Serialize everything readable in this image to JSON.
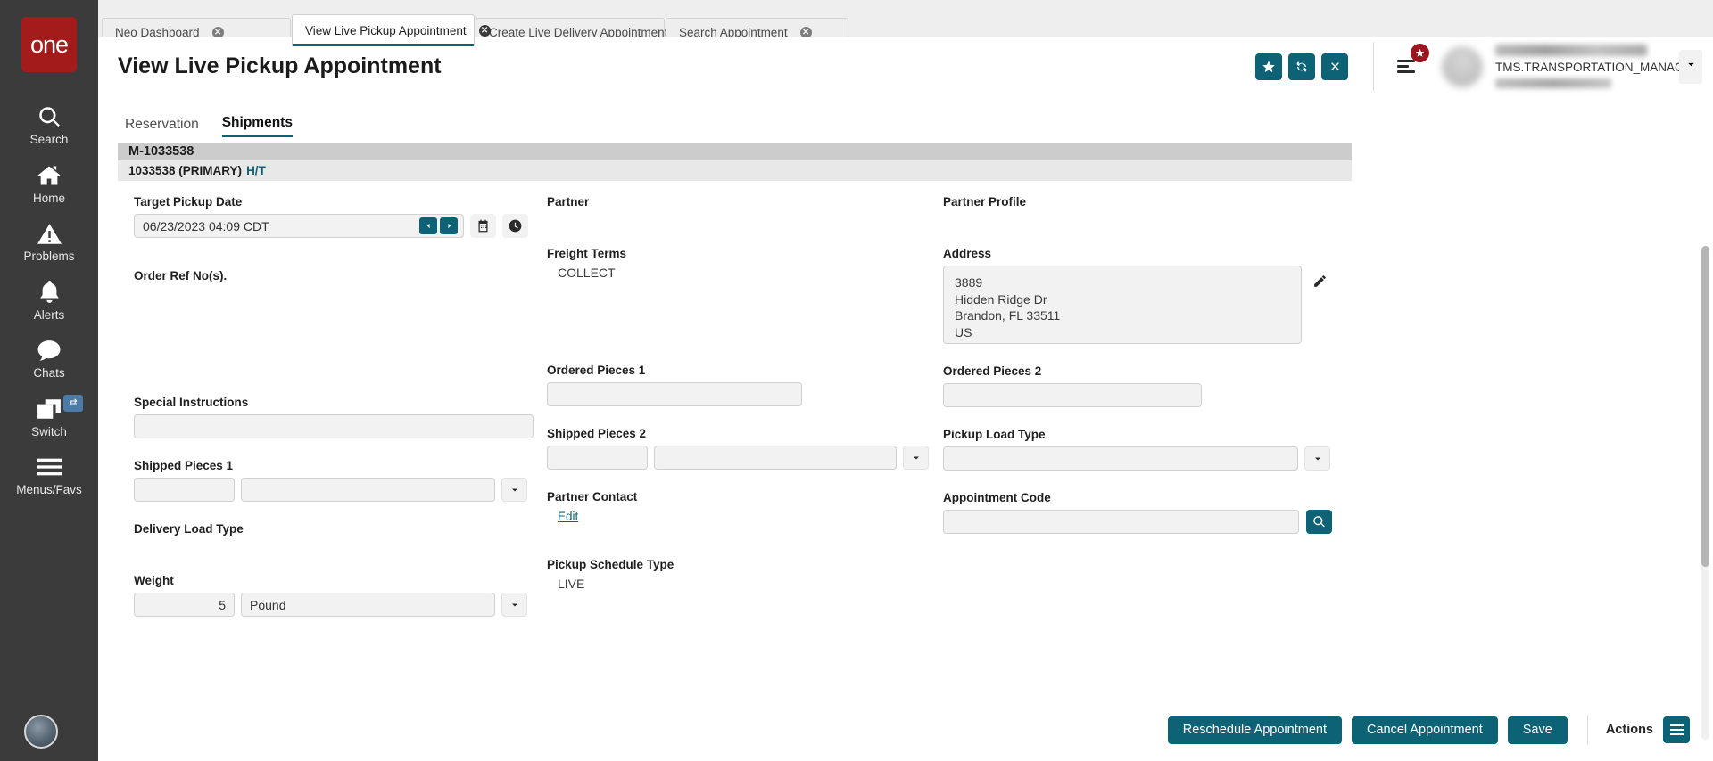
{
  "sidebar": {
    "logo_text": "one",
    "items": [
      {
        "label": "Search",
        "icon": "search-icon"
      },
      {
        "label": "Home",
        "icon": "home-icon"
      },
      {
        "label": "Problems",
        "icon": "warning-triangle-icon"
      },
      {
        "label": "Alerts",
        "icon": "bell-icon"
      },
      {
        "label": "Chats",
        "icon": "chat-bubble-icon"
      },
      {
        "label": "Switch",
        "icon": "windows-stack-icon",
        "badge": "⇄"
      },
      {
        "label": "Menus/Favs",
        "icon": "hamburger-icon"
      }
    ]
  },
  "tabs": [
    {
      "label": "Neo Dashboard",
      "active": false
    },
    {
      "label": "View Live Pickup Appointment",
      "active": true
    },
    {
      "label": "Create Live Delivery Appointment",
      "active": false
    },
    {
      "label": "Search Appointment",
      "active": false
    }
  ],
  "header": {
    "title": "View Live Pickup Appointment",
    "buttons": [
      {
        "name": "favorite-button",
        "icon": "star-icon"
      },
      {
        "name": "refresh-button",
        "icon": "refresh-icon"
      },
      {
        "name": "close-button",
        "icon": "x-icon"
      }
    ],
    "user": {
      "role": "TMS.TRANSPORTATION_MANAGER"
    }
  },
  "content": {
    "subtabs": [
      {
        "label": "Reservation",
        "active": false
      },
      {
        "label": "Shipments",
        "active": true
      }
    ],
    "movement_band": "M-1033538",
    "shipment_band": "1033538 (PRIMARY)",
    "shipment_band_link": "H/T"
  },
  "form": {
    "target_pickup_date": {
      "label": "Target Pickup Date",
      "value": "06/23/2023 04:09 CDT"
    },
    "partner": {
      "label": "Partner",
      "value": ""
    },
    "partner_profile": {
      "label": "Partner Profile",
      "value": ""
    },
    "order_ref_nos": {
      "label": "Order Ref No(s).",
      "value": ""
    },
    "freight_terms": {
      "label": "Freight Terms",
      "value": "COLLECT"
    },
    "address": {
      "label": "Address",
      "lines": [
        "3889",
        "Hidden Ridge Dr",
        "Brandon, FL  33511",
        "US"
      ]
    },
    "special_instructions": {
      "label": "Special Instructions",
      "value": ""
    },
    "ordered_pieces_1": {
      "label": "Ordered Pieces 1",
      "value": ""
    },
    "ordered_pieces_2": {
      "label": "Ordered Pieces 2",
      "value": ""
    },
    "shipped_pieces_1": {
      "label": "Shipped Pieces 1",
      "qty": "",
      "unit": ""
    },
    "shipped_pieces_2": {
      "label": "Shipped Pieces 2",
      "qty": "",
      "unit": ""
    },
    "pickup_load_type": {
      "label": "Pickup Load Type",
      "value": ""
    },
    "delivery_load_type": {
      "label": "Delivery Load Type",
      "value": ""
    },
    "partner_contact": {
      "label": "Partner Contact",
      "edit_link": "Edit"
    },
    "appointment_code": {
      "label": "Appointment Code",
      "value": ""
    },
    "weight": {
      "label": "Weight",
      "qty": "5",
      "unit": "Pound"
    },
    "pickup_schedule_type": {
      "label": "Pickup Schedule Type",
      "value": "LIVE"
    }
  },
  "footer": {
    "reschedule_label": "Reschedule Appointment",
    "cancel_label": "Cancel Appointment",
    "save_label": "Save",
    "actions_label": "Actions"
  },
  "colors": {
    "teal": "#0d6275",
    "brand_red": "#a41b1b",
    "sidebar": "#3b3b3b",
    "link": "#0d6275"
  }
}
